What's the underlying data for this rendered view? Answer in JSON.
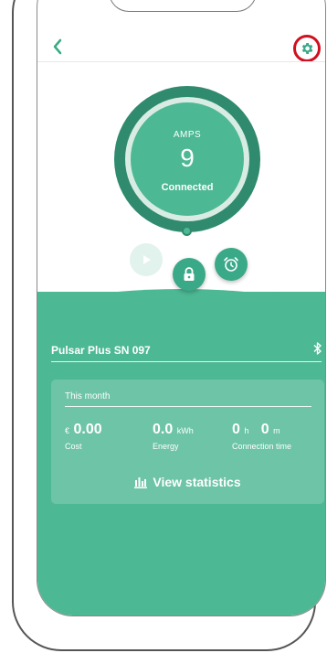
{
  "header": {
    "back_icon": "chevron-left-icon",
    "settings_icon": "gear-icon"
  },
  "charger": {
    "amps_label": "AMPS",
    "amps_value": "9",
    "status": "Connected",
    "name": "Pulsar Plus SN 097",
    "connection_icon": "bluetooth-icon"
  },
  "controls": [
    {
      "name": "play",
      "icon": "play-icon",
      "enabled": false
    },
    {
      "name": "lock",
      "icon": "lock-icon",
      "enabled": true
    },
    {
      "name": "schedule",
      "icon": "alarm-clock-icon",
      "enabled": true
    }
  ],
  "summary": {
    "title": "This month",
    "cost": {
      "currency": "€",
      "value": "0.00",
      "label": "Cost"
    },
    "energy": {
      "value": "0.0",
      "unit": "kWh",
      "label": "Energy"
    },
    "connection_time": {
      "hours": "0",
      "hours_unit": "h",
      "minutes": "0",
      "minutes_unit": "m",
      "label": "Connection time"
    },
    "view_stats_label": "View statistics"
  },
  "colors": {
    "primary_green": "#4db894",
    "dark_green": "#2f8a6e",
    "highlight_red": "#d01020"
  }
}
